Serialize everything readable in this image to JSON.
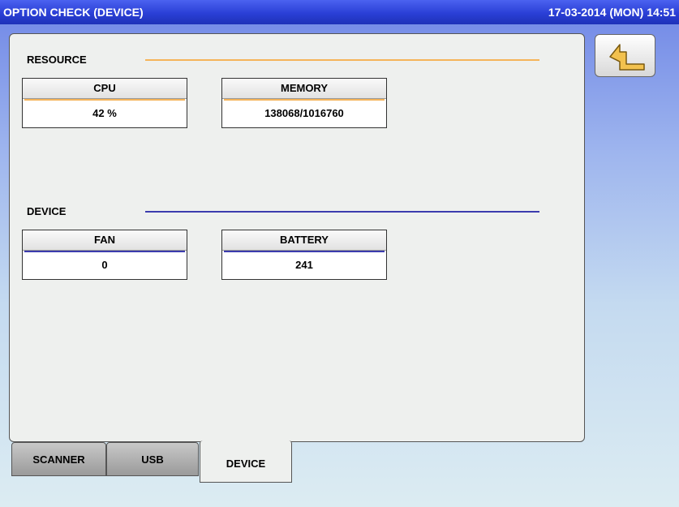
{
  "window": {
    "title": "OPTION CHECK (DEVICE)",
    "datetime": "17-03-2014 (MON)  14:51"
  },
  "resource": {
    "label": "RESOURCE",
    "accent": "#f5b45a",
    "cpu": {
      "label": "CPU",
      "value": "42 %"
    },
    "memory": {
      "label": "MEMORY",
      "value": "138068/1016760"
    }
  },
  "device": {
    "label": "DEVICE",
    "accent": "#3c3cae",
    "fan": {
      "label": "FAN",
      "value": "0"
    },
    "battery": {
      "label": "BATTERY",
      "value": "241"
    }
  },
  "tabs": [
    {
      "label": "SCANNER",
      "active": false
    },
    {
      "label": "USB",
      "active": false
    },
    {
      "label": "DEVICE",
      "active": true
    }
  ],
  "back_button": {
    "icon": "return-arrow-icon"
  }
}
